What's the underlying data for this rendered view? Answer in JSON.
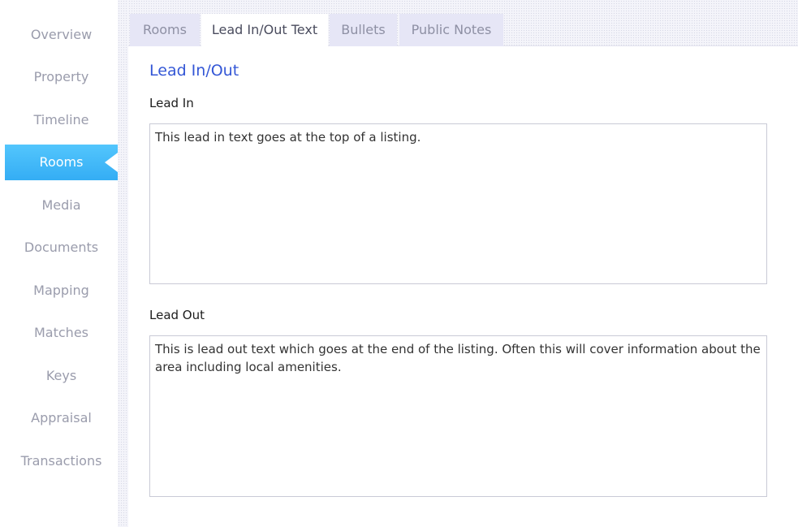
{
  "sidebar": {
    "items": [
      {
        "label": "Overview"
      },
      {
        "label": "Property"
      },
      {
        "label": "Timeline"
      },
      {
        "label": "Rooms",
        "active": true
      },
      {
        "label": "Media"
      },
      {
        "label": "Documents"
      },
      {
        "label": "Mapping"
      },
      {
        "label": "Matches"
      },
      {
        "label": "Keys"
      },
      {
        "label": "Appraisal"
      },
      {
        "label": "Transactions"
      }
    ],
    "active_color": "#3fb8f8"
  },
  "tabs": [
    {
      "label": "Rooms"
    },
    {
      "label": "Lead In/Out Text",
      "active": true
    },
    {
      "label": "Bullets"
    },
    {
      "label": "Public Notes"
    }
  ],
  "content": {
    "section_title": "Lead In/Out",
    "lead_in": {
      "label": "Lead In",
      "value": "This lead in text goes at the top of a listing."
    },
    "lead_out": {
      "label": "Lead Out",
      "value": "This is lead out text which goes at the end of the listing. Often this will cover information about the area including local amenities."
    }
  }
}
